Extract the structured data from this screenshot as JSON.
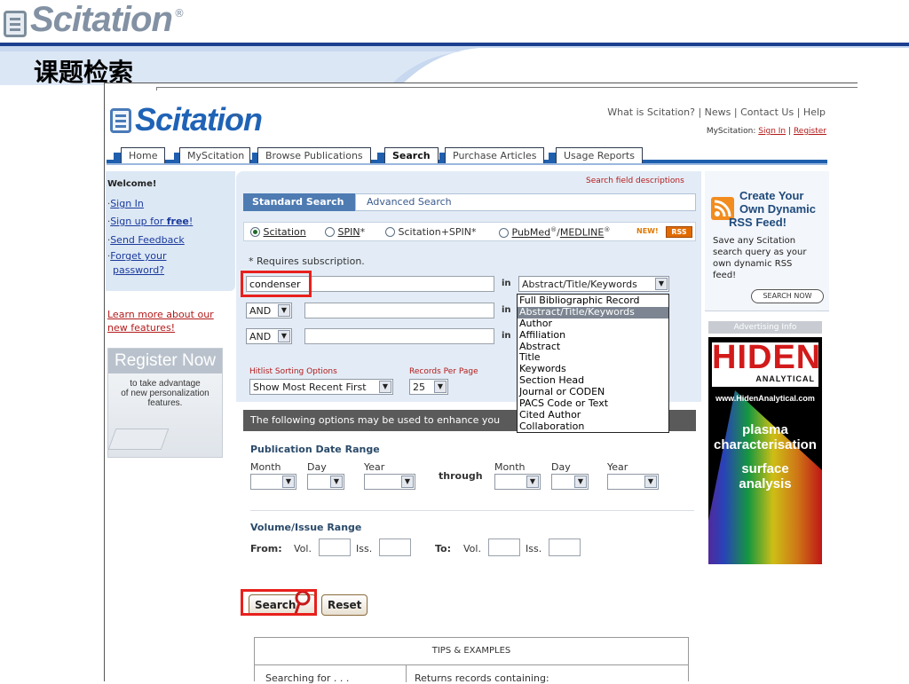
{
  "slide": {
    "logo_text": "Scitation",
    "logo_reg": "®",
    "title": "课题检索"
  },
  "browser": {
    "logo_text": "Scitation",
    "logo_tm": "™",
    "top_links": [
      "What is Scitation?",
      "News",
      "Contact Us",
      "Help"
    ],
    "top_sep": "|",
    "myscitation_label": "MyScitation:",
    "sign_in": "Sign In",
    "register": "Register",
    "tabs": [
      "Home",
      "MyScitation",
      "Browse Publications",
      "Search",
      "Purchase Articles",
      "Usage Reports"
    ],
    "sidebar": {
      "welcome": "Welcome!",
      "sign_in": "Sign In",
      "sign_up_prefix": "Sign up for ",
      "sign_up_bold": "free",
      "sign_up_suffix": "!",
      "send_feedback": "Send Feedback",
      "forget_line1": "Forget your",
      "forget_line2": "password?",
      "learn_line1": "Learn more about our",
      "learn_line2": "new features!",
      "register_title": "Register Now",
      "register_sub1": "to take advantage",
      "register_sub2": "of new personalization",
      "register_sub3": "features."
    },
    "search": {
      "field_desc": "Search field descriptions",
      "tab_standard": "Standard Search",
      "tab_advanced": "Advanced Search",
      "radios": [
        "Scitation",
        "SPIN",
        "Scitation+SPIN",
        "PubMed",
        "MEDLINE"
      ],
      "star": "*",
      "reg_mark": "®",
      "slash": "/",
      "new_badge": "NEW!",
      "rss_badge": "RSS",
      "requires_sub": "* Requires subscription.",
      "query1": "condenser",
      "in_label": "in",
      "field1": "Abstract/Title/Keywords",
      "op2": "AND",
      "op3": "AND",
      "dropdown_options": [
        "Full Bibliographic Record",
        "Abstract/Title/Keywords",
        "Author",
        "Affiliation",
        "Abstract",
        "Title",
        "Keywords",
        "Section Head",
        "Journal or CODEN",
        "PACS Code or Text",
        "Cited Author",
        "Collaboration"
      ],
      "dropdown_selected_index": 1,
      "sort_label": "Hitlist Sorting Options",
      "sort_value": "Show Most Recent First",
      "records_label": "Records Per Page",
      "records_value": "25",
      "options_bar": "The following options may be used to enhance you",
      "pub_date_title": "Publication Date Range",
      "month": "Month",
      "day": "Day",
      "year": "Year",
      "through": "through",
      "volume_title": "Volume/Issue Range",
      "from": "From:",
      "to": "To:",
      "vol": "Vol.",
      "iss": "Iss.",
      "search_btn": "Search",
      "reset_btn": "Reset",
      "tips_title": "TIPS & EXAMPLES",
      "tips_col1": "Searching for . . .",
      "tips_col2": "Returns records containing:"
    },
    "right": {
      "rss_title1": "Create Your",
      "rss_title2": "Own Dynamic",
      "rss_title3": "RSS Feed!",
      "rss_desc1": "Save any Scitation",
      "rss_desc2": "search query as your",
      "rss_desc3": "own dynamic RSS",
      "rss_desc4": "feed!",
      "search_now": "SEARCH NOW",
      "advertising": "Advertising Info",
      "ad_brand": "HIDEN",
      "ad_sub": "ANALYTICAL",
      "ad_url": "www.HidenAnalytical.com",
      "ad_line1": "plasma",
      "ad_line2": "characterisation",
      "ad_line3": "surface",
      "ad_line4": "analysis"
    }
  },
  "colors": {
    "accent_blue": "#1f5fae",
    "highlight_red": "#e8201c",
    "link_red": "#b41a1a"
  }
}
